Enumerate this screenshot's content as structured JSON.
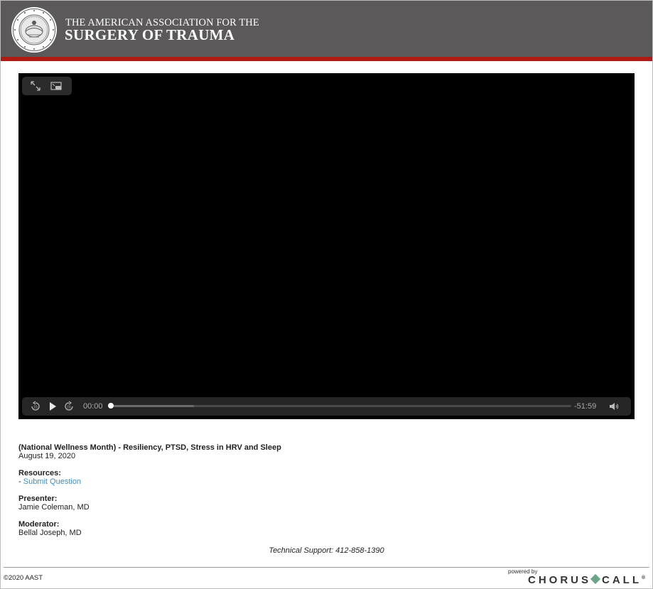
{
  "header": {
    "org_line1": "THE AMERICAN ASSOCIATION FOR THE",
    "org_line2": "SURGERY OF TRAUMA",
    "seal_text": "THE AMERICAN ASSOCIATION FOR THE SURGERY OF TRAUMA",
    "bg_color": "#5b5959",
    "accent_color": "#b01a14"
  },
  "player": {
    "current_time": "00:00",
    "remaining_time": "-51:59",
    "progress": 0.0,
    "buffered": 0.18,
    "icons": {
      "fullscreen": "expand-icon",
      "pip": "picture-in-picture-icon",
      "rewind": "rewind-15-icon",
      "play": "play-icon",
      "forward": "forward-15-icon",
      "volume": "volume-icon"
    }
  },
  "event": {
    "title": "(National Wellness Month) - Resiliency, PTSD, Stress in HRV and Sleep",
    "date": "August 19, 2020",
    "resources_label": "Resources:",
    "resource_prefix": "- ",
    "resource_link": "Submit Question",
    "presenter_label": "Presenter:",
    "presenter": "Jamie Coleman, MD",
    "moderator_label": "Moderator:",
    "moderator": "Bellal Joseph, MD"
  },
  "footer": {
    "support": "Technical Support: 412-858-1390",
    "copyright": "©2020 AAST",
    "powered_by": "powered by",
    "brand_left": "CHORUS",
    "brand_right": "CALL",
    "brand_mark": "®",
    "link_color": "#3a8fc6"
  }
}
